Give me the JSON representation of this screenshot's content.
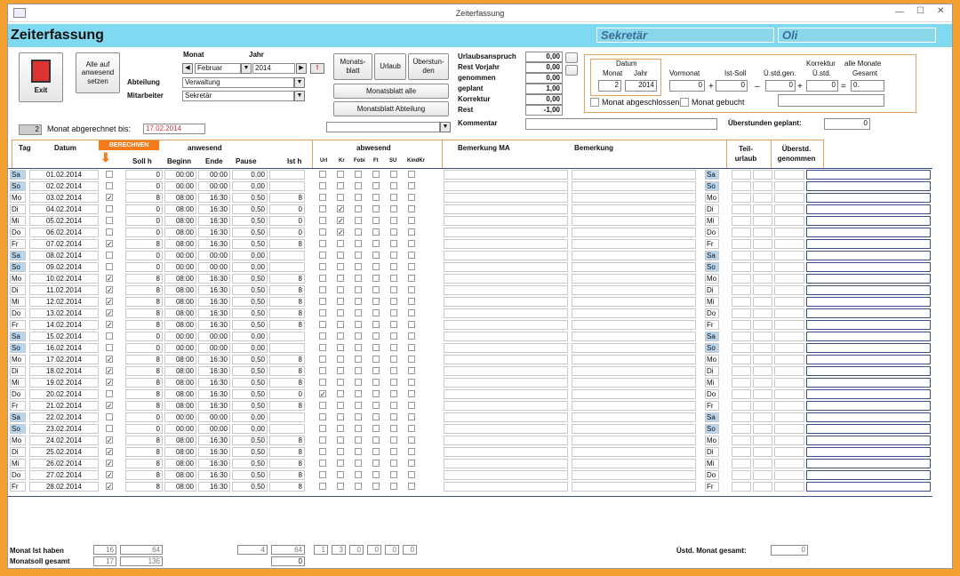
{
  "window": {
    "title": "Zeiterfassung"
  },
  "header": {
    "title": "Zeiterfassung",
    "user_field1": "Sekretär",
    "user_field2": "Oli"
  },
  "controls": {
    "exit_label": "Exit",
    "alle_auf_anwesend_label": "Alle auf anwesend setzen",
    "monat_label": "Monat",
    "jahr_label": "Jahr",
    "monat_value": "Februar",
    "jahr_value": "2014",
    "abteilung_label": "Abteilung",
    "abteilung_value": "Verwaltung",
    "mitarbeiter_label": "Mitarbeiter",
    "mitarbeiter_value": "Sekretär",
    "monatsblatt_label": "Monats-blatt",
    "urlaub_label": "Urlaub",
    "ueberstunden_label": "Überstun-den",
    "monatsblatt_alle_label": "Monatsblatt alle",
    "monatsblatt_abteilung_label": "Monatsblatt Abteilung",
    "abgerechnet_count": "2",
    "abgerechnet_label": "Monat abgerechnet bis:",
    "abgerechnet_value": "17.02.2014"
  },
  "urlaub": {
    "items": [
      {
        "label": "Urlaubsanspruch",
        "value": "0,00"
      },
      {
        "label": "Rest Vorjahr",
        "value": "0,00"
      },
      {
        "label": "genommen",
        "value": "0,00"
      },
      {
        "label": "geplant",
        "value": "1,00"
      },
      {
        "label": "Korrektur",
        "value": "0,00"
      },
      {
        "label": "Rest",
        "value": "-1,00"
      }
    ],
    "kommentar_label": "Kommentar"
  },
  "korrektur": {
    "datum_label": "Datum",
    "monat_label": "Monat",
    "jahr_label": "Jahr",
    "monat_value": "2",
    "jahr_value": "2014",
    "vormonat_label": "Vormonat",
    "vormonat_value": "0",
    "istsoll_label": "Ist-Soll",
    "istsoll_value": "0",
    "ustdgen_label": "Ü.std.gen.",
    "ustdgen_value": "0",
    "korrektur_label": "Korrektur",
    "ustd_label": "Ü.std.",
    "korrektur_value": "0",
    "alle_monate_label": "alle Monate",
    "gesamt_label": "Gesamt",
    "gesamt_value": "0.",
    "plus1": "+",
    "minus": "–",
    "plus2": "+",
    "eq": "=",
    "abgeschlossen_label": "Monat abgeschlossen",
    "gebucht_label": "Monat gebucht",
    "ueberstunden_geplant_label": "Überstunden geplant:",
    "ueberstunden_geplant_value": "0"
  },
  "table": {
    "headers": {
      "tag": "Tag",
      "datum": "Datum",
      "berechnen": "BERECHNEN",
      "anwesend": "anwesend",
      "abwesend": "abwesend",
      "bemerkung_ma": "Bemerkung MA",
      "bemerkung": "Bemerkung",
      "teilurlaub": "Teil-urlaub",
      "ueberstd": "Überstd. genommen"
    },
    "subheaders": {
      "soll": "Soll h",
      "beginn": "Beginn",
      "ende": "Ende",
      "pause": "Pause",
      "ist": "Ist h",
      "url": "Url",
      "kr": "Kr",
      "fobi": "Fobi",
      "ft": "Ft",
      "su": "SU",
      "kindkr": "KindKr"
    },
    "rows": [
      {
        "tag": "Sa",
        "datum": "01.02.2014",
        "check": "",
        "soll": "0",
        "beginn": "00:00",
        "ende": "00:00",
        "pause": "0,00",
        "ist": "",
        "abs": [
          "",
          "",
          "",
          "",
          "",
          ""
        ]
      },
      {
        "tag": "So",
        "datum": "02.02.2014",
        "check": "",
        "soll": "0",
        "beginn": "00:00",
        "ende": "00:00",
        "pause": "0,00",
        "ist": "",
        "abs": [
          "",
          "",
          "",
          "",
          "",
          ""
        ]
      },
      {
        "tag": "Mo",
        "datum": "03.02.2014",
        "check": "✓",
        "soll": "8",
        "beginn": "08:00",
        "ende": "16:30",
        "pause": "0,50",
        "ist": "8",
        "abs": [
          "",
          "",
          "",
          "",
          "",
          ""
        ]
      },
      {
        "tag": "Di",
        "datum": "04.02.2014",
        "check": "",
        "soll": "0",
        "beginn": "08:00",
        "ende": "16:30",
        "pause": "0,50",
        "ist": "0",
        "abs": [
          "",
          "✓",
          "",
          "",
          "",
          ""
        ]
      },
      {
        "tag": "Mi",
        "datum": "05.02.2014",
        "check": "",
        "soll": "0",
        "beginn": "08:00",
        "ende": "16:30",
        "pause": "0,50",
        "ist": "0",
        "abs": [
          "",
          "✓",
          "",
          "",
          "",
          ""
        ]
      },
      {
        "tag": "Do",
        "datum": "06.02.2014",
        "check": "",
        "soll": "0",
        "beginn": "08:00",
        "ende": "16:30",
        "pause": "0,50",
        "ist": "0",
        "abs": [
          "",
          "✓",
          "",
          "",
          "",
          ""
        ]
      },
      {
        "tag": "Fr",
        "datum": "07.02.2014",
        "check": "✓",
        "soll": "8",
        "beginn": "08:00",
        "ende": "16:30",
        "pause": "0,50",
        "ist": "8",
        "abs": [
          "",
          "",
          "",
          "",
          "",
          ""
        ]
      },
      {
        "tag": "Sa",
        "datum": "08.02.2014",
        "check": "",
        "soll": "0",
        "beginn": "00:00",
        "ende": "00:00",
        "pause": "0,00",
        "ist": "",
        "abs": [
          "",
          "",
          "",
          "",
          "",
          ""
        ]
      },
      {
        "tag": "So",
        "datum": "09.02.2014",
        "check": "",
        "soll": "0",
        "beginn": "00:00",
        "ende": "00:00",
        "pause": "0,00",
        "ist": "",
        "abs": [
          "",
          "",
          "",
          "",
          "",
          ""
        ]
      },
      {
        "tag": "Mo",
        "datum": "10.02.2014",
        "check": "✓",
        "soll": "8",
        "beginn": "08:00",
        "ende": "16:30",
        "pause": "0,50",
        "ist": "8",
        "abs": [
          "",
          "",
          "",
          "",
          "",
          ""
        ]
      },
      {
        "tag": "Di",
        "datum": "11.02.2014",
        "check": "✓",
        "soll": "8",
        "beginn": "08:00",
        "ende": "16:30",
        "pause": "0,50",
        "ist": "8",
        "abs": [
          "",
          "",
          "",
          "",
          "",
          ""
        ]
      },
      {
        "tag": "Mi",
        "datum": "12.02.2014",
        "check": "✓",
        "soll": "8",
        "beginn": "08:00",
        "ende": "16:30",
        "pause": "0,50",
        "ist": "8",
        "abs": [
          "",
          "",
          "",
          "",
          "",
          ""
        ]
      },
      {
        "tag": "Do",
        "datum": "13.02.2014",
        "check": "✓",
        "soll": "8",
        "beginn": "08:00",
        "ende": "16:30",
        "pause": "0,50",
        "ist": "8",
        "abs": [
          "",
          "",
          "",
          "",
          "",
          ""
        ]
      },
      {
        "tag": "Fr",
        "datum": "14.02.2014",
        "check": "✓",
        "soll": "8",
        "beginn": "08:00",
        "ende": "16:30",
        "pause": "0,50",
        "ist": "8",
        "abs": [
          "",
          "",
          "",
          "",
          "",
          ""
        ]
      },
      {
        "tag": "Sa",
        "datum": "15.02.2014",
        "check": "",
        "soll": "0",
        "beginn": "00:00",
        "ende": "00:00",
        "pause": "0,00",
        "ist": "",
        "abs": [
          "",
          "",
          "",
          "",
          "",
          ""
        ]
      },
      {
        "tag": "So",
        "datum": "16.02.2014",
        "check": "",
        "soll": "0",
        "beginn": "00:00",
        "ende": "00:00",
        "pause": "0,00",
        "ist": "",
        "abs": [
          "",
          "",
          "",
          "",
          "",
          ""
        ]
      },
      {
        "tag": "Mo",
        "datum": "17.02.2014",
        "check": "✓",
        "soll": "8",
        "beginn": "08:00",
        "ende": "16:30",
        "pause": "0,50",
        "ist": "8",
        "abs": [
          "",
          "",
          "",
          "",
          "",
          ""
        ]
      },
      {
        "tag": "Di",
        "datum": "18.02.2014",
        "check": "✓",
        "soll": "8",
        "beginn": "08:00",
        "ende": "16:30",
        "pause": "0,50",
        "ist": "8",
        "abs": [
          "",
          "",
          "",
          "",
          "",
          ""
        ]
      },
      {
        "tag": "Mi",
        "datum": "19.02.2014",
        "check": "✓",
        "soll": "8",
        "beginn": "08:00",
        "ende": "16:30",
        "pause": "0,50",
        "ist": "8",
        "abs": [
          "",
          "",
          "",
          "",
          "",
          ""
        ]
      },
      {
        "tag": "Do",
        "datum": "20.02.2014",
        "check": "",
        "soll": "8",
        "beginn": "08:00",
        "ende": "16:30",
        "pause": "0,50",
        "ist": "0",
        "abs": [
          "✓",
          "",
          "",
          "",
          "",
          ""
        ]
      },
      {
        "tag": "Fr",
        "datum": "21.02.2014",
        "check": "✓",
        "soll": "8",
        "beginn": "08:00",
        "ende": "16:30",
        "pause": "0,50",
        "ist": "8",
        "abs": [
          "",
          "",
          "",
          "",
          "",
          ""
        ]
      },
      {
        "tag": "Sa",
        "datum": "22.02.2014",
        "check": "",
        "soll": "0",
        "beginn": "00:00",
        "ende": "00:00",
        "pause": "0,00",
        "ist": "",
        "abs": [
          "",
          "",
          "",
          "",
          "",
          ""
        ]
      },
      {
        "tag": "So",
        "datum": "23.02.2014",
        "check": "",
        "soll": "0",
        "beginn": "00:00",
        "ende": "00:00",
        "pause": "0,00",
        "ist": "",
        "abs": [
          "",
          "",
          "",
          "",
          "",
          ""
        ]
      },
      {
        "tag": "Mo",
        "datum": "24.02.2014",
        "check": "✓",
        "soll": "8",
        "beginn": "08:00",
        "ende": "16:30",
        "pause": "0,50",
        "ist": "8",
        "abs": [
          "",
          "",
          "",
          "",
          "",
          ""
        ]
      },
      {
        "tag": "Di",
        "datum": "25.02.2014",
        "check": "✓",
        "soll": "8",
        "beginn": "08:00",
        "ende": "16:30",
        "pause": "0,50",
        "ist": "8",
        "abs": [
          "",
          "",
          "",
          "",
          "",
          ""
        ]
      },
      {
        "tag": "Mi",
        "datum": "26.02.2014",
        "check": "✓",
        "soll": "8",
        "beginn": "08:00",
        "ende": "16:30",
        "pause": "0,50",
        "ist": "8",
        "abs": [
          "",
          "",
          "",
          "",
          "",
          ""
        ]
      },
      {
        "tag": "Do",
        "datum": "27.02.2014",
        "check": "✓",
        "soll": "8",
        "beginn": "08:00",
        "ende": "16:30",
        "pause": "0,50",
        "ist": "8",
        "abs": [
          "",
          "",
          "",
          "",
          "",
          ""
        ]
      },
      {
        "tag": "Fr",
        "datum": "28.02.2014",
        "check": "✓",
        "soll": "8",
        "beginn": "08:00",
        "ende": "16:30",
        "pause": "0,50",
        "ist": "8",
        "abs": [
          "",
          "",
          "",
          "",
          "",
          ""
        ]
      }
    ]
  },
  "footer": {
    "ist_label": "Monat Ist haben",
    "soll_label": "Monatsoll gesamt",
    "ist_days": "16",
    "ist_hours": "64",
    "soll_days": "17",
    "soll_hours": "136",
    "pause_total": "4",
    "ist_total": "64",
    "ist_diff": "0",
    "abs_totals": [
      "1",
      "3",
      "0",
      "0",
      "0",
      "0"
    ],
    "ustd_label": "Üstd. Monat gesamt:",
    "ustd_value": "0"
  },
  "colors": {
    "accent": "#f4a030",
    "header_bg": "#7fd9f0",
    "weekend": "#b9d6ef",
    "berechnen": "#f47a1a"
  }
}
